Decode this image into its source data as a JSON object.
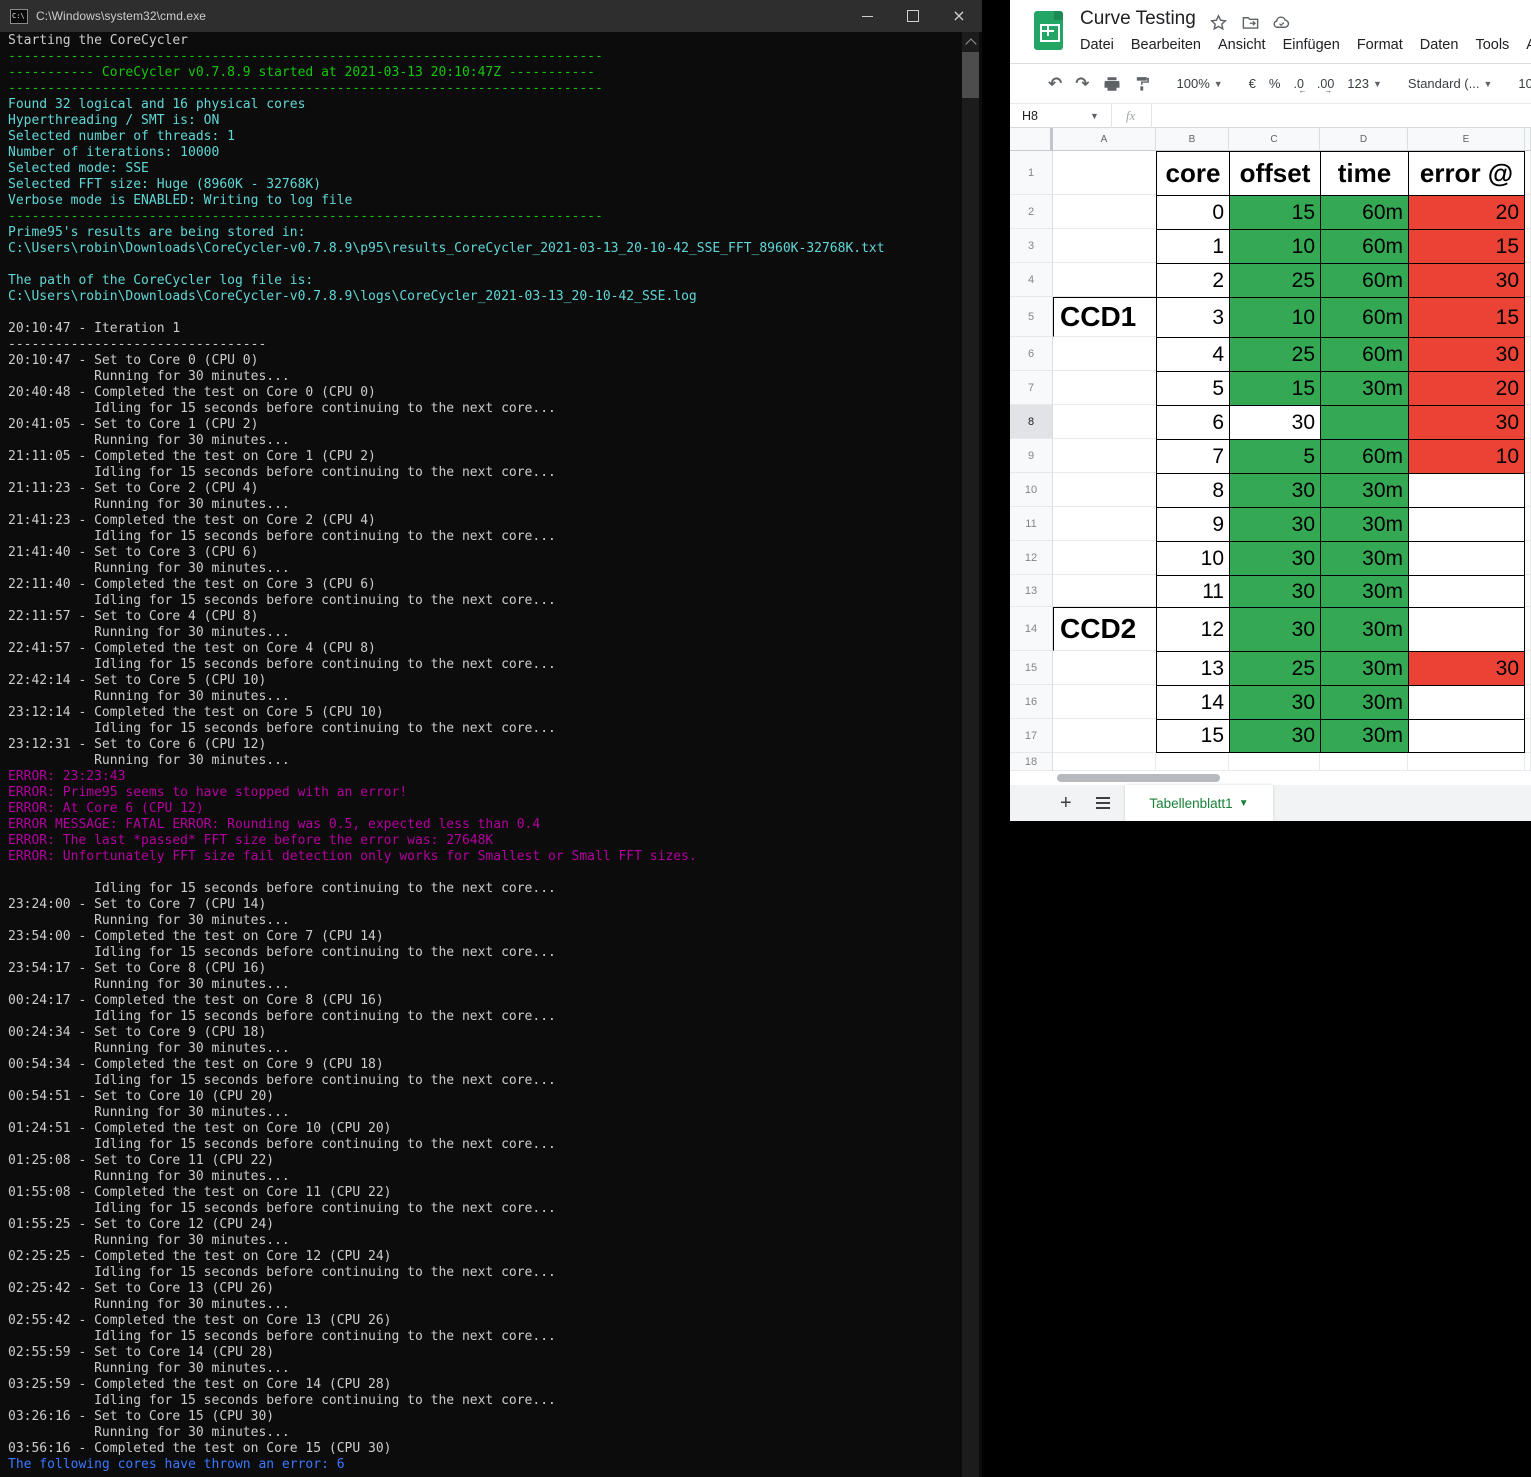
{
  "palette": {
    "term_white": "#cccccc",
    "term_green": "#16c60c",
    "term_cyan": "#61d6d6",
    "term_magenta": "#b4009e",
    "term_blue": "#3b78ff",
    "sheet_green": "#34a853",
    "sheet_red": "#ea4335",
    "tab_green": "#188038"
  },
  "terminal": {
    "title": "C:\\Windows\\system32\\cmd.exe",
    "separators": {
      "long": "----------------------------------------------------------------------------",
      "short": "---------------------------------"
    },
    "lines": [
      {
        "t": "Starting the CoreCycler",
        "c": "w"
      },
      {
        "sep": "long",
        "c": "g"
      },
      {
        "t": "----------- CoreCycler v0.7.8.9 started at 2021-03-13 20:10:47Z -----------",
        "c": "g"
      },
      {
        "sep": "long",
        "c": "g"
      },
      {
        "t": "Found 32 logical and 16 physical cores",
        "c": "c"
      },
      {
        "t": "Hyperthreading / SMT is: ON",
        "c": "c"
      },
      {
        "t": "Selected number of threads: 1",
        "c": "c"
      },
      {
        "t": "Number of iterations: 10000",
        "c": "c"
      },
      {
        "t": "Selected mode: SSE",
        "c": "c"
      },
      {
        "t": "Selected FFT size: Huge (8960K - 32768K)",
        "c": "c"
      },
      {
        "t": "Verbose mode is ENABLED: Writing to log file",
        "c": "c"
      },
      {
        "sep": "long",
        "c": "g"
      },
      {
        "t": "Prime95's results are being stored in:",
        "c": "c"
      },
      {
        "t": "C:\\Users\\robin\\Downloads\\CoreCycler-v0.7.8.9\\p95\\results_CoreCycler_2021-03-13_20-10-42_SSE_FFT_8960K-32768K.txt",
        "c": "c"
      },
      {
        "t": "",
        "c": "w"
      },
      {
        "t": "The path of the CoreCycler log file is:",
        "c": "c"
      },
      {
        "t": "C:\\Users\\robin\\Downloads\\CoreCycler-v0.7.8.9\\logs\\CoreCycler_2021-03-13_20-10-42_SSE.log",
        "c": "c"
      },
      {
        "t": "",
        "c": "w"
      },
      {
        "t": "20:10:47 - Iteration 1",
        "c": "w"
      },
      {
        "sep": "short",
        "c": "w"
      },
      {
        "t": "20:10:47 - Set to Core 0 (CPU 0)",
        "c": "w"
      },
      {
        "t": "           Running for 30 minutes...",
        "c": "w"
      },
      {
        "t": "20:40:48 - Completed the test on Core 0 (CPU 0)",
        "c": "w"
      },
      {
        "t": "           Idling for 15 seconds before continuing to the next core...",
        "c": "w"
      },
      {
        "t": "20:41:05 - Set to Core 1 (CPU 2)",
        "c": "w"
      },
      {
        "t": "           Running for 30 minutes...",
        "c": "w"
      },
      {
        "t": "21:11:05 - Completed the test on Core 1 (CPU 2)",
        "c": "w"
      },
      {
        "t": "           Idling for 15 seconds before continuing to the next core...",
        "c": "w"
      },
      {
        "t": "21:11:23 - Set to Core 2 (CPU 4)",
        "c": "w"
      },
      {
        "t": "           Running for 30 minutes...",
        "c": "w"
      },
      {
        "t": "21:41:23 - Completed the test on Core 2 (CPU 4)",
        "c": "w"
      },
      {
        "t": "           Idling for 15 seconds before continuing to the next core...",
        "c": "w"
      },
      {
        "t": "21:41:40 - Set to Core 3 (CPU 6)",
        "c": "w"
      },
      {
        "t": "           Running for 30 minutes...",
        "c": "w"
      },
      {
        "t": "22:11:40 - Completed the test on Core 3 (CPU 6)",
        "c": "w"
      },
      {
        "t": "           Idling for 15 seconds before continuing to the next core...",
        "c": "w"
      },
      {
        "t": "22:11:57 - Set to Core 4 (CPU 8)",
        "c": "w"
      },
      {
        "t": "           Running for 30 minutes...",
        "c": "w"
      },
      {
        "t": "22:41:57 - Completed the test on Core 4 (CPU 8)",
        "c": "w"
      },
      {
        "t": "           Idling for 15 seconds before continuing to the next core...",
        "c": "w"
      },
      {
        "t": "22:42:14 - Set to Core 5 (CPU 10)",
        "c": "w"
      },
      {
        "t": "           Running for 30 minutes...",
        "c": "w"
      },
      {
        "t": "23:12:14 - Completed the test on Core 5 (CPU 10)",
        "c": "w"
      },
      {
        "t": "           Idling for 15 seconds before continuing to the next core...",
        "c": "w"
      },
      {
        "t": "23:12:31 - Set to Core 6 (CPU 12)",
        "c": "w"
      },
      {
        "t": "           Running for 30 minutes...",
        "c": "w"
      },
      {
        "t": "ERROR: 23:23:43",
        "c": "m"
      },
      {
        "t": "ERROR: Prime95 seems to have stopped with an error!",
        "c": "m"
      },
      {
        "t": "ERROR: At Core 6 (CPU 12)",
        "c": "m"
      },
      {
        "t": "ERROR MESSAGE: FATAL ERROR: Rounding was 0.5, expected less than 0.4",
        "c": "m"
      },
      {
        "t": "ERROR: The last *passed* FFT size before the error was: 27648K",
        "c": "m"
      },
      {
        "t": "ERROR: Unfortunately FFT size fail detection only works for Smallest or Small FFT sizes.",
        "c": "m"
      },
      {
        "t": "",
        "c": "w"
      },
      {
        "t": "           Idling for 15 seconds before continuing to the next core...",
        "c": "w"
      },
      {
        "t": "23:24:00 - Set to Core 7 (CPU 14)",
        "c": "w"
      },
      {
        "t": "           Running for 30 minutes...",
        "c": "w"
      },
      {
        "t": "23:54:00 - Completed the test on Core 7 (CPU 14)",
        "c": "w"
      },
      {
        "t": "           Idling for 15 seconds before continuing to the next core...",
        "c": "w"
      },
      {
        "t": "23:54:17 - Set to Core 8 (CPU 16)",
        "c": "w"
      },
      {
        "t": "           Running for 30 minutes...",
        "c": "w"
      },
      {
        "t": "00:24:17 - Completed the test on Core 8 (CPU 16)",
        "c": "w"
      },
      {
        "t": "           Idling for 15 seconds before continuing to the next core...",
        "c": "w"
      },
      {
        "t": "00:24:34 - Set to Core 9 (CPU 18)",
        "c": "w"
      },
      {
        "t": "           Running for 30 minutes...",
        "c": "w"
      },
      {
        "t": "00:54:34 - Completed the test on Core 9 (CPU 18)",
        "c": "w"
      },
      {
        "t": "           Idling for 15 seconds before continuing to the next core...",
        "c": "w"
      },
      {
        "t": "00:54:51 - Set to Core 10 (CPU 20)",
        "c": "w"
      },
      {
        "t": "           Running for 30 minutes...",
        "c": "w"
      },
      {
        "t": "01:24:51 - Completed the test on Core 10 (CPU 20)",
        "c": "w"
      },
      {
        "t": "           Idling for 15 seconds before continuing to the next core...",
        "c": "w"
      },
      {
        "t": "01:25:08 - Set to Core 11 (CPU 22)",
        "c": "w"
      },
      {
        "t": "           Running for 30 minutes...",
        "c": "w"
      },
      {
        "t": "01:55:08 - Completed the test on Core 11 (CPU 22)",
        "c": "w"
      },
      {
        "t": "           Idling for 15 seconds before continuing to the next core...",
        "c": "w"
      },
      {
        "t": "01:55:25 - Set to Core 12 (CPU 24)",
        "c": "w"
      },
      {
        "t": "           Running for 30 minutes...",
        "c": "w"
      },
      {
        "t": "02:25:25 - Completed the test on Core 12 (CPU 24)",
        "c": "w"
      },
      {
        "t": "           Idling for 15 seconds before continuing to the next core...",
        "c": "w"
      },
      {
        "t": "02:25:42 - Set to Core 13 (CPU 26)",
        "c": "w"
      },
      {
        "t": "           Running for 30 minutes...",
        "c": "w"
      },
      {
        "t": "02:55:42 - Completed the test on Core 13 (CPU 26)",
        "c": "w"
      },
      {
        "t": "           Idling for 15 seconds before continuing to the next core...",
        "c": "w"
      },
      {
        "t": "02:55:59 - Set to Core 14 (CPU 28)",
        "c": "w"
      },
      {
        "t": "           Running for 30 minutes...",
        "c": "w"
      },
      {
        "t": "03:25:59 - Completed the test on Core 14 (CPU 28)",
        "c": "w"
      },
      {
        "t": "           Idling for 15 seconds before continuing to the next core...",
        "c": "w"
      },
      {
        "t": "03:26:16 - Set to Core 15 (CPU 30)",
        "c": "w"
      },
      {
        "t": "           Running for 30 minutes...",
        "c": "w"
      },
      {
        "t": "03:56:16 - Completed the test on Core 15 (CPU 30)",
        "c": "w"
      },
      {
        "t": "The following cores have thrown an error: 6",
        "c": "b"
      }
    ]
  },
  "sheets": {
    "title": "Curve Testing",
    "menu": [
      "Datei",
      "Bearbeiten",
      "Ansicht",
      "Einfügen",
      "Format",
      "Daten",
      "Tools",
      "Add-ons"
    ],
    "toolbar": {
      "zoom": "100%",
      "currency": "€",
      "percent": "%",
      "dec_decrease": ".0",
      "dec_increase": ".00",
      "number_format": "123",
      "font_name": "Standard (...",
      "font_size": "10"
    },
    "formula_bar": {
      "name_box": "H8",
      "fx": "fx"
    },
    "grid": {
      "columns": [
        "A",
        "B",
        "C",
        "D",
        "E"
      ],
      "header_row": {
        "b": "core",
        "c": "offset",
        "d": "time",
        "e": "error @"
      },
      "rows": [
        {
          "n": 2,
          "a": "",
          "b": "0",
          "c": "15",
          "d": "60m",
          "e": "20",
          "cf": "green",
          "df": "green",
          "ef": "red"
        },
        {
          "n": 3,
          "a": "",
          "b": "1",
          "c": "10",
          "d": "60m",
          "e": "15",
          "cf": "green",
          "df": "green",
          "ef": "red"
        },
        {
          "n": 4,
          "a": "",
          "b": "2",
          "c": "25",
          "d": "60m",
          "e": "30",
          "cf": "green",
          "df": "green",
          "ef": "red"
        },
        {
          "n": 5,
          "a": "CCD1",
          "b": "3",
          "c": "10",
          "d": "60m",
          "e": "15",
          "cf": "green",
          "df": "green",
          "ef": "red",
          "group": true
        },
        {
          "n": 6,
          "a": "",
          "b": "4",
          "c": "25",
          "d": "60m",
          "e": "30",
          "cf": "green",
          "df": "green",
          "ef": "red"
        },
        {
          "n": 7,
          "a": "",
          "b": "5",
          "c": "15",
          "d": "30m",
          "e": "20",
          "cf": "green",
          "df": "green",
          "ef": "red"
        },
        {
          "n": 8,
          "a": "",
          "b": "6",
          "c": "30",
          "d": "",
          "e": "30",
          "cf": "white",
          "df": "green",
          "ef": "red",
          "selected": true
        },
        {
          "n": 9,
          "a": "",
          "b": "7",
          "c": "5",
          "d": "60m",
          "e": "10",
          "cf": "green",
          "df": "green",
          "ef": "red"
        },
        {
          "n": 10,
          "a": "",
          "b": "8",
          "c": "30",
          "d": "30m",
          "e": "",
          "cf": "green",
          "df": "green",
          "ef": "white"
        },
        {
          "n": 11,
          "a": "",
          "b": "9",
          "c": "30",
          "d": "30m",
          "e": "",
          "cf": "green",
          "df": "green",
          "ef": "white"
        },
        {
          "n": 12,
          "a": "",
          "b": "10",
          "c": "30",
          "d": "30m",
          "e": "",
          "cf": "green",
          "df": "green",
          "ef": "white"
        },
        {
          "n": 13,
          "a": "",
          "b": "11",
          "c": "30",
          "d": "30m",
          "e": "",
          "cf": "green",
          "df": "green",
          "ef": "white"
        },
        {
          "n": 14,
          "a": "CCD2",
          "b": "12",
          "c": "30",
          "d": "30m",
          "e": "",
          "cf": "green",
          "df": "green",
          "ef": "white",
          "group": true
        },
        {
          "n": 15,
          "a": "",
          "b": "13",
          "c": "25",
          "d": "30m",
          "e": "30",
          "cf": "green",
          "df": "green",
          "ef": "red"
        },
        {
          "n": 16,
          "a": "",
          "b": "14",
          "c": "30",
          "d": "30m",
          "e": "",
          "cf": "green",
          "df": "green",
          "ef": "white"
        },
        {
          "n": 17,
          "a": "",
          "b": "15",
          "c": "30",
          "d": "30m",
          "e": "",
          "cf": "green",
          "df": "green",
          "ef": "white"
        }
      ],
      "selected_cell": "H8",
      "last_row_number": 18
    },
    "sheet_tab": "Tabellenblatt1"
  }
}
